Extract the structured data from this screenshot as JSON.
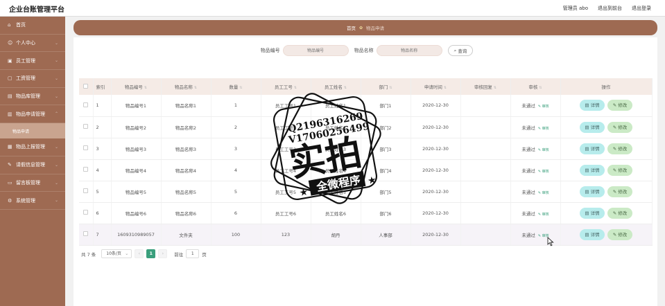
{
  "header": {
    "title": "企业台账管理平台",
    "admin": "管理员 abo",
    "to_front": "退出到前台",
    "logout": "退出登录"
  },
  "sidebar": {
    "items": [
      {
        "label": "首页",
        "icon": "home-icon"
      },
      {
        "label": "个人中心",
        "icon": "user-icon"
      },
      {
        "label": "员工管理",
        "icon": "staff-icon"
      },
      {
        "label": "工资管理",
        "icon": "salary-icon"
      },
      {
        "label": "物品库管理",
        "icon": "box-icon"
      },
      {
        "label": "物品申请管理",
        "icon": "apply-icon"
      },
      {
        "label": "物品上报管理",
        "icon": "report-icon"
      },
      {
        "label": "请假信息管理",
        "icon": "leave-icon"
      },
      {
        "label": "留言板管理",
        "icon": "message-icon"
      },
      {
        "label": "系统管理",
        "icon": "settings-icon"
      }
    ],
    "active_sub": "物品申请"
  },
  "breadcrumb": {
    "home": "首页",
    "current": "物品申请"
  },
  "search": {
    "code_label": "物品编号",
    "code_placeholder": "物品编号",
    "name_label": "物品名称",
    "name_placeholder": "物品名称",
    "query_button": "查询"
  },
  "table": {
    "headers": [
      "索引",
      "物品编号",
      "物品名称",
      "数量",
      "员工工号",
      "员工姓名",
      "部门",
      "申请时间",
      "审核回复",
      "审核",
      "操作"
    ],
    "rows": [
      {
        "index": "1",
        "code": "物品编号1",
        "name": "物品名称1",
        "qty": "1",
        "emp_no": "员工工号1",
        "emp_name": "员工姓名1",
        "dept": "部门1",
        "date": "2020-12-30",
        "reply": "",
        "status": "未通过"
      },
      {
        "index": "2",
        "code": "物品编号2",
        "name": "物品名称2",
        "qty": "2",
        "emp_no": "员工工号2",
        "emp_name": "员工姓名2",
        "dept": "部门2",
        "date": "2020-12-30",
        "reply": "",
        "status": "未通过"
      },
      {
        "index": "3",
        "code": "物品编号3",
        "name": "物品名称3",
        "qty": "3",
        "emp_no": "员工工号3",
        "emp_name": "员工姓名3",
        "dept": "部门3",
        "date": "2020-12-30",
        "reply": "",
        "status": "未通过"
      },
      {
        "index": "4",
        "code": "物品编号4",
        "name": "物品名称4",
        "qty": "4",
        "emp_no": "员工工号4",
        "emp_name": "员工姓名4",
        "dept": "部门4",
        "date": "2020-12-30",
        "reply": "",
        "status": "未通过"
      },
      {
        "index": "5",
        "code": "物品编号5",
        "name": "物品名称5",
        "qty": "5",
        "emp_no": "员工工号5",
        "emp_name": "员工姓名5",
        "dept": "部门5",
        "date": "2020-12-30",
        "reply": "",
        "status": "未通过"
      },
      {
        "index": "6",
        "code": "物品编号6",
        "name": "物品名称6",
        "qty": "6",
        "emp_no": "员工工号6",
        "emp_name": "员工姓名6",
        "dept": "部门6",
        "date": "2020-12-30",
        "reply": "",
        "status": "未通过"
      },
      {
        "index": "7",
        "code": "1609310989057",
        "name": "文件夹",
        "qty": "100",
        "emp_no": "123",
        "emp_name": "胡丹",
        "dept": "人事部",
        "date": "2020-12-30",
        "reply": "",
        "status": "未通过"
      }
    ],
    "audit_link": "审核",
    "detail_button": "详情",
    "edit_button": "修改"
  },
  "pagination": {
    "total": "共 7 条",
    "page_size": "10条/页",
    "current_page": "1",
    "goto_label": "前往",
    "goto_value": "1",
    "page_suffix": "页"
  },
  "watermark": {
    "line1": "Q2196316269",
    "line2": "V17060256499",
    "big": "实拍",
    "banner": "全微程序"
  },
  "colors": {
    "sidebar": "#9e6a52",
    "active_sub": "#c9a48f",
    "accent": "#3a9f7c",
    "detail_btn": "#b7ecec",
    "edit_btn": "#cbeac6"
  }
}
